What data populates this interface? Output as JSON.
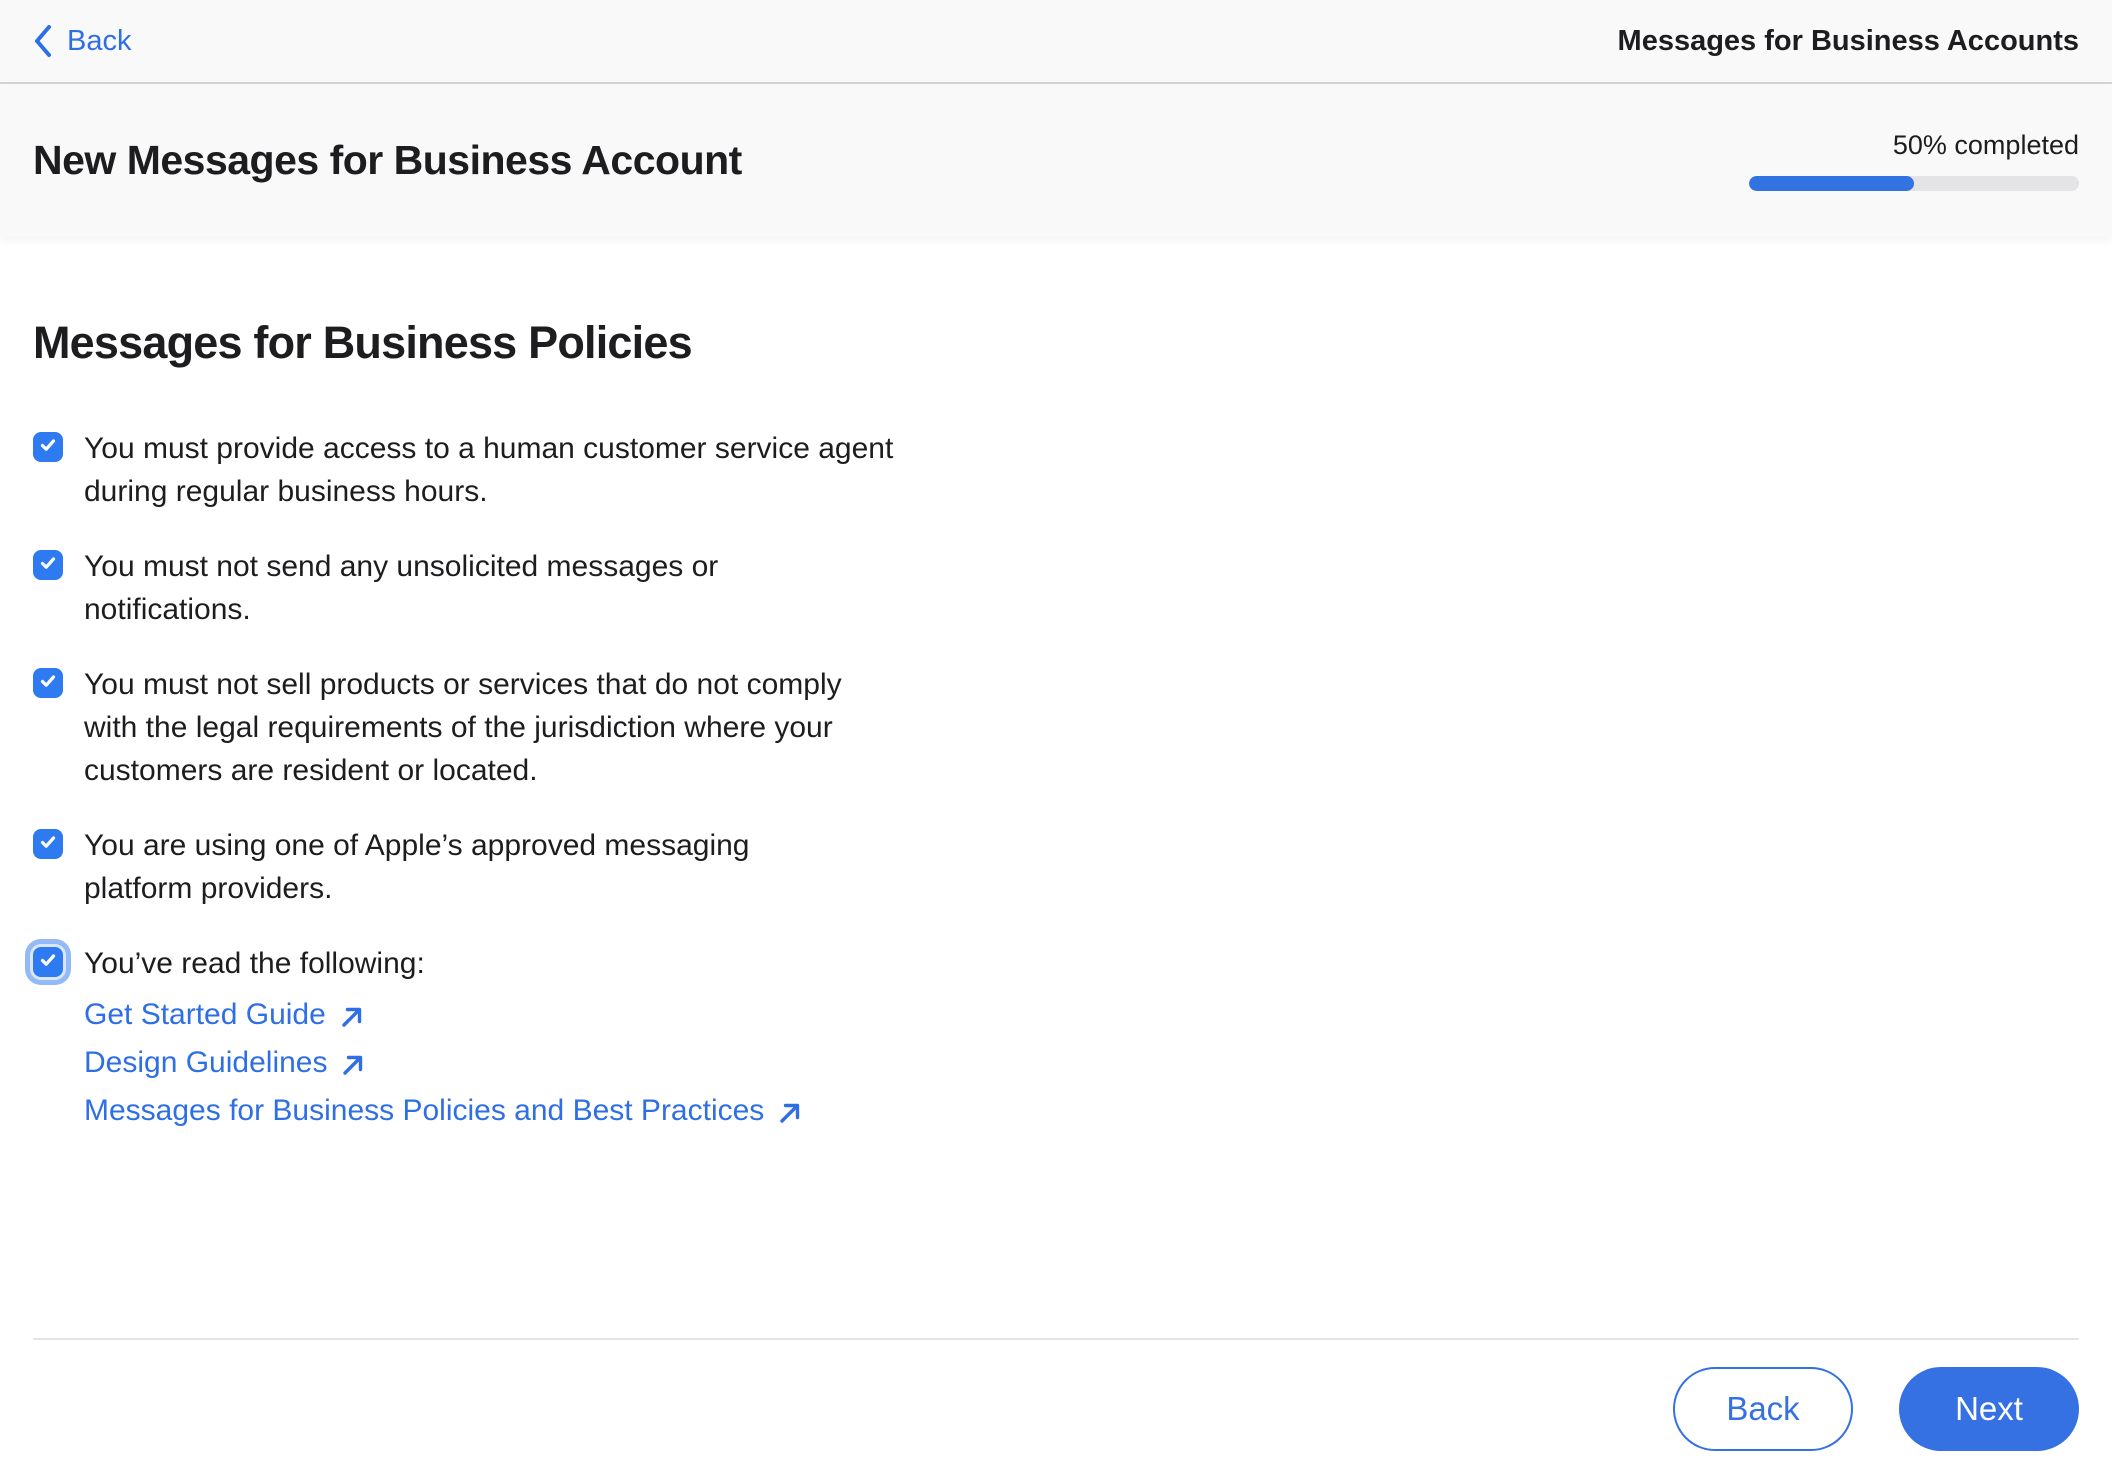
{
  "theme": {
    "text": "#1d1d1f",
    "link-blue": "#2f6fe4",
    "checkbox-blue": "#2e7af1",
    "button-blue": "#3571e3",
    "progress-blue": "#3273e1",
    "halo": "#93b9f6",
    "track": "#e4e4e7",
    "header-bg": "#f9f9fa",
    "divider": "#d2d2d7",
    "footer-divider": "#e4e4e6"
  },
  "nav": {
    "back_label": "Back",
    "title": "Messages for Business Accounts"
  },
  "header": {
    "title": "New Messages for Business Account",
    "progress_label": "50% completed",
    "progress_percent": 50
  },
  "content": {
    "heading": "Messages for Business Policies",
    "policies": [
      {
        "checked": true,
        "focused": false,
        "lines": [
          "You must provide access to a human customer service agent",
          "during regular business hours."
        ],
        "links": []
      },
      {
        "checked": true,
        "focused": false,
        "lines": [
          "You must not send any unsolicited messages or",
          "notifications."
        ],
        "links": []
      },
      {
        "checked": true,
        "focused": false,
        "lines": [
          "You must not sell products or services that do not comply",
          "with the legal requirements of the jurisdiction where your",
          "customers are resident or located."
        ],
        "links": []
      },
      {
        "checked": true,
        "focused": false,
        "lines": [
          "You are using one of Apple’s approved messaging",
          "platform providers."
        ],
        "links": []
      },
      {
        "checked": true,
        "focused": true,
        "lines": [
          "You’ve read the following:"
        ],
        "links": [
          {
            "label": "Get Started Guide"
          },
          {
            "label": "Design Guidelines"
          },
          {
            "label": "Messages for Business Policies and Best Practices"
          }
        ]
      }
    ]
  },
  "footer": {
    "back_label": "Back",
    "next_label": "Next"
  }
}
